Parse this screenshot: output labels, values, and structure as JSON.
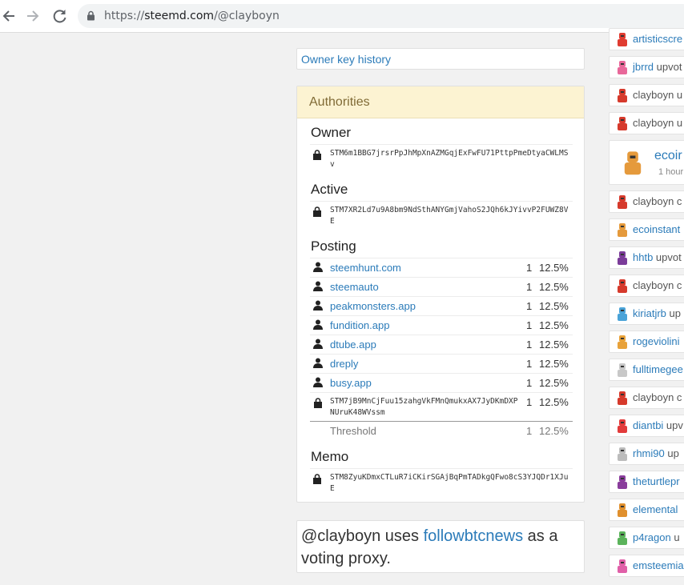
{
  "browser": {
    "url_scheme": "https://",
    "url_host": "steemd.com",
    "url_path": "/@clayboyn"
  },
  "owner_key_history": {
    "label": "Owner key history"
  },
  "authorities": {
    "title": "Authorities",
    "owner": {
      "label": "Owner",
      "key": "STM6m1BBG7jrsrPpJhMpXnAZMGqjExFwFU71PttpPmeDtyaCWLMSv"
    },
    "active": {
      "label": "Active",
      "key": "STM7XR2Ld7u9A8bm9NdSthANYGmjVahoS2JQh6kJYivvP2FUWZ8VE"
    },
    "posting": {
      "label": "Posting",
      "accounts": [
        {
          "name": "steemhunt.com",
          "weight": "1",
          "pct": "12.5%"
        },
        {
          "name": "steemauto",
          "weight": "1",
          "pct": "12.5%"
        },
        {
          "name": "peakmonsters.app",
          "weight": "1",
          "pct": "12.5%"
        },
        {
          "name": "fundition.app",
          "weight": "1",
          "pct": "12.5%"
        },
        {
          "name": "dtube.app",
          "weight": "1",
          "pct": "12.5%"
        },
        {
          "name": "dreply",
          "weight": "1",
          "pct": "12.5%"
        },
        {
          "name": "busy.app",
          "weight": "1",
          "pct": "12.5%"
        }
      ],
      "key": {
        "value": "STM7jB9MnCjFuu15zahgVkFMnQmukxAX7JyDKmDXPNUruK48WVssm",
        "weight": "1",
        "pct": "12.5%"
      },
      "threshold": {
        "label": "Threshold",
        "weight": "1",
        "pct": "12.5%"
      }
    },
    "memo": {
      "label": "Memo",
      "key": "STM8ZyuKDmxCTLuR7iCKirSGAjBqPmTADkgQFwo8cS3YJQDr1XJuE"
    }
  },
  "proxy": {
    "prefix": "@clayboyn uses ",
    "link": "followbtcnews",
    "suffix": " as a voting proxy."
  },
  "feed": [
    {
      "user": "artisticscre",
      "action": "",
      "avatar_color": "#e03c31"
    },
    {
      "user": "jbrrd",
      "action": " upvot",
      "avatar_color": "#e8689a"
    },
    {
      "user": "",
      "action": "clayboyn u",
      "avatar_color": "#d63a2c"
    },
    {
      "user": "",
      "action": "clayboyn u",
      "avatar_color": "#d63a2c"
    },
    {
      "user": "ecoir",
      "action": "",
      "sub": "1 hour",
      "avatar_color": "#e59a3c",
      "big": true
    },
    {
      "user": "",
      "action": "clayboyn c",
      "avatar_color": "#d63a2c"
    },
    {
      "user": "ecoinstant",
      "action": "",
      "avatar_color": "#e59a3c"
    },
    {
      "user": "hhtb",
      "action": " upvot",
      "avatar_color": "#7b3c99"
    },
    {
      "user": "",
      "action": "clayboyn c",
      "avatar_color": "#d63a2c"
    },
    {
      "user": "kiriatjrb",
      "action": " up",
      "avatar_color": "#4aa3d8"
    },
    {
      "user": "rogeviolini",
      "action": "",
      "avatar_color": "#e8a23a"
    },
    {
      "user": "fulltimegee",
      "action": "",
      "avatar_color": "#c8c8c8"
    },
    {
      "user": "",
      "action": "clayboyn c",
      "avatar_color": "#d63a2c"
    },
    {
      "user": "diantbi",
      "action": " upv",
      "avatar_color": "#e23b3b"
    },
    {
      "user": "rhmi90",
      "action": " up",
      "avatar_color": "#bcbcbc"
    },
    {
      "user": "theturtlepr",
      "action": "",
      "avatar_color": "#8a3d9c"
    },
    {
      "user": "elemental",
      "action": "",
      "avatar_color": "#e0902e"
    },
    {
      "user": "p4ragon",
      "action": " u",
      "avatar_color": "#5bb35b"
    },
    {
      "user": "emsteemia",
      "action": "",
      "avatar_color": "#e060a8"
    }
  ]
}
